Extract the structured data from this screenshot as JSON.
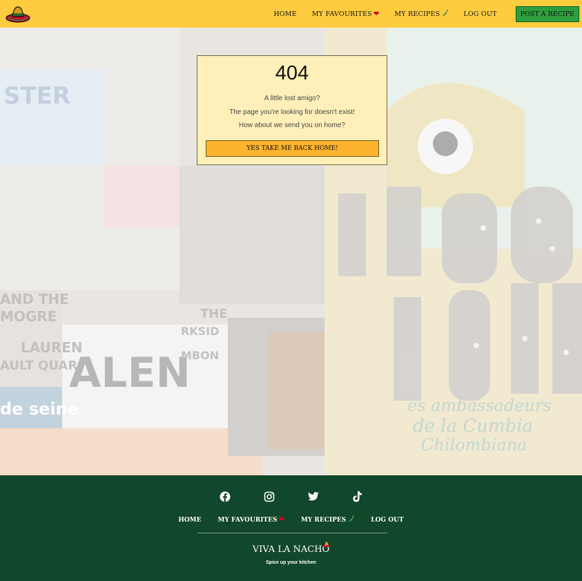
{
  "navbar": {
    "logo_icon": "sombrero-icon",
    "links": [
      {
        "label": "HOME",
        "icon": ""
      },
      {
        "label": "MY FAVOURITES",
        "icon": "heart-icon"
      },
      {
        "label": "MY RECIPES",
        "icon": "chili-pepper-icon"
      },
      {
        "label": "LOG OUT",
        "icon": ""
      }
    ],
    "post_button": "POST A RECIPE"
  },
  "error_card": {
    "code": "404",
    "line1": "A little lost amigo?",
    "line2": "The page you're looking for doesn't exist!",
    "line3": "How about we send you on home?",
    "button": "YES TAKE ME BACK HOME!"
  },
  "footer": {
    "social": [
      "facebook-icon",
      "instagram-icon",
      "twitter-icon",
      "tiktok-icon"
    ],
    "links": [
      {
        "label": "HOME"
      },
      {
        "label": "MY FAVOURITES",
        "icon": "heart-icon"
      },
      {
        "label": "MY RECIPES",
        "icon": "chili-pepper-icon"
      },
      {
        "label": "LOG OUT"
      }
    ],
    "brand": "VIVA LA NACHO",
    "tagline": "Spice up your kitchen"
  },
  "colors": {
    "navbar_bg": "#ffcc3f",
    "footer_bg": "#11472a",
    "card_bg": "#fff0ba",
    "button_bg": "#fdb32d",
    "post_button_bg": "#2e9e3d"
  }
}
